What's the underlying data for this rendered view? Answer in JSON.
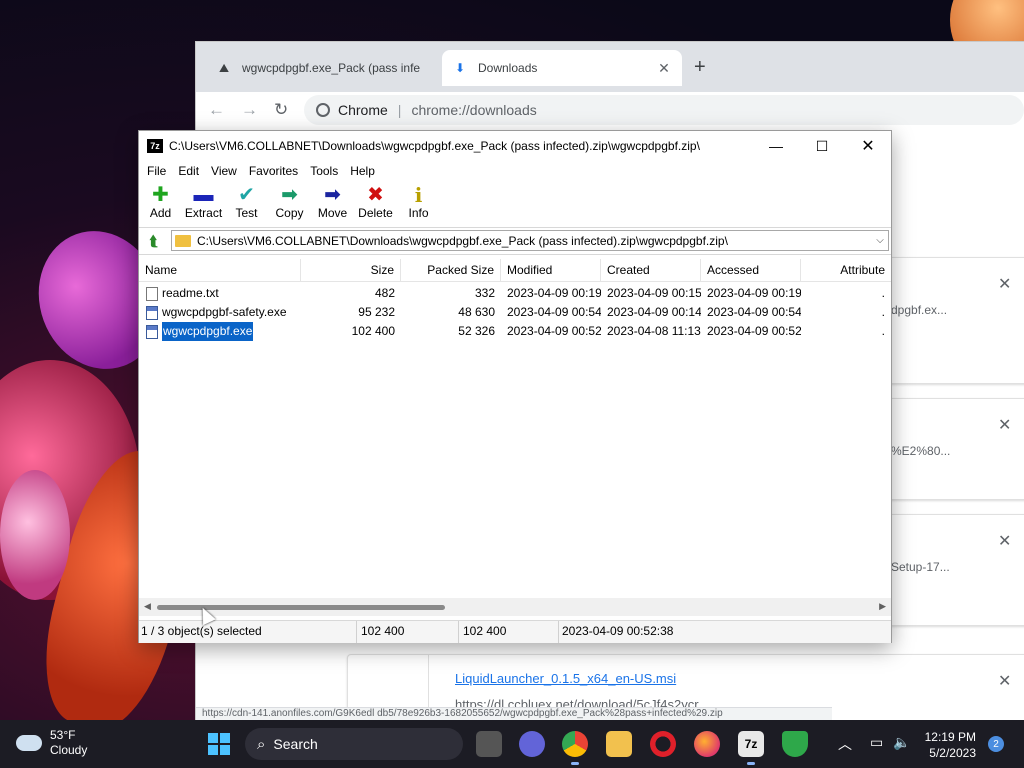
{
  "chrome": {
    "tabs": [
      {
        "title": "wgwcpdpgbf.exe_Pack (pass infe",
        "icon": "tree-logo-icon"
      },
      {
        "title": "Downloads",
        "icon": "download-icon"
      }
    ],
    "omnibox": {
      "site_label": "Chrome",
      "url": "chrome://downloads"
    },
    "downloads": [
      {
        "partial_name": "dpgbf.ex..."
      },
      {
        "partial_name": "%E2%80..."
      },
      {
        "partial_name": "Setup-17..."
      },
      {
        "name": "LiquidLauncher_0.1.5_x64_en-US.msi",
        "source": "https://dl.ccbluex.net/download/5cJf4s2ycr"
      }
    ],
    "status_url": "https://cdn-141.anonfiles.com/G9K6edl db5/78e926b3-1682055652/wgwcpdpgbf.exe_Pack%28pass+infected%29.zip"
  },
  "sevenzip": {
    "title": "C:\\Users\\VM6.COLLABNET\\Downloads\\wgwcpdpgbf.exe_Pack (pass infected).zip\\wgwcpdpgbf.zip\\",
    "logo": "7z",
    "menu": [
      "File",
      "Edit",
      "View",
      "Favorites",
      "Tools",
      "Help"
    ],
    "toolbar": [
      {
        "label": "Add",
        "icon": "add-icon",
        "glyph": "✚"
      },
      {
        "label": "Extract",
        "icon": "extract-icon",
        "glyph": "▬"
      },
      {
        "label": "Test",
        "icon": "test-icon",
        "glyph": "✔"
      },
      {
        "label": "Copy",
        "icon": "copy-icon",
        "glyph": "➡"
      },
      {
        "label": "Move",
        "icon": "move-icon",
        "glyph": "➡"
      },
      {
        "label": "Delete",
        "icon": "delete-icon",
        "glyph": "✖"
      },
      {
        "label": "Info",
        "icon": "info-icon",
        "glyph": "i"
      }
    ],
    "address": "C:\\Users\\VM6.COLLABNET\\Downloads\\wgwcpdpgbf.exe_Pack (pass infected).zip\\wgwcpdpgbf.zip\\",
    "columns": [
      "Name",
      "Size",
      "Packed Size",
      "Modified",
      "Created",
      "Accessed",
      "Attribute"
    ],
    "files": [
      {
        "name": "readme.txt",
        "type": "txt",
        "size": "482",
        "packed": "332",
        "modified": "2023-04-09 00:19",
        "created": "2023-04-09 00:15",
        "accessed": "2023-04-09 00:19",
        "attr": ".",
        "selected": false
      },
      {
        "name": "wgwcpdpgbf-safety.exe",
        "type": "exe",
        "size": "95 232",
        "packed": "48 630",
        "modified": "2023-04-09 00:54",
        "created": "2023-04-09 00:14",
        "accessed": "2023-04-09 00:54",
        "attr": ".",
        "selected": false
      },
      {
        "name": "wgwcpdpgbf.exe",
        "type": "exe",
        "size": "102 400",
        "packed": "52 326",
        "modified": "2023-04-09 00:52",
        "created": "2023-04-08 11:13",
        "accessed": "2023-04-09 00:52",
        "attr": ".",
        "selected": true
      }
    ],
    "status": {
      "selection": "1 / 3 object(s) selected",
      "size": "102 400",
      "packed": "102 400",
      "modified": "2023-04-09 00:52:38"
    }
  },
  "taskbar": {
    "weather": {
      "temp": "53°F",
      "condition": "Cloudy"
    },
    "search_label": "Search",
    "apps": [
      "task-view-icon",
      "teams-chat-icon",
      "chrome-icon",
      "file-explorer-icon",
      "opera-icon",
      "firefox-icon",
      "sevenzip-icon",
      "security-shield-icon"
    ],
    "sevenzip_label": "7z",
    "time": "12:19 PM",
    "date": "5/2/2023",
    "notifications": "2"
  }
}
